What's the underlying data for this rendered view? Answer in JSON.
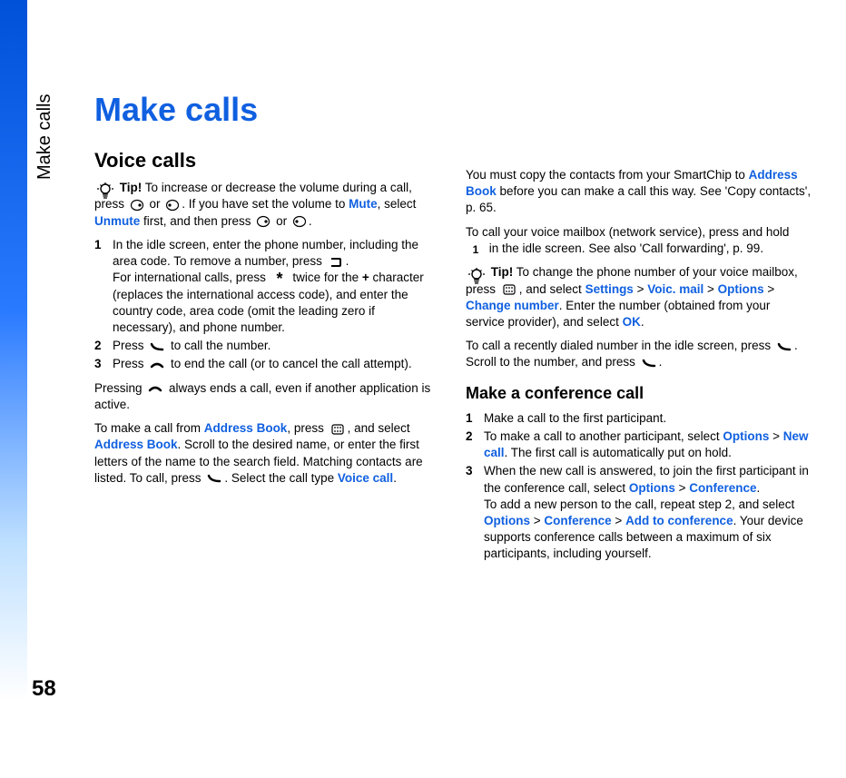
{
  "page_number": "58",
  "side_label": "Make calls",
  "title": "Make calls",
  "section_voice": "Voice calls",
  "tip_label": "Tip!",
  "tip1_a": " To increase or decrease the volume during a call, press ",
  "tip1_b": " or ",
  "tip1_c": ". If you have set the volume to ",
  "mute": "Mute",
  "tip1_d": ", select ",
  "unmute": "Unmute",
  "tip1_e": " first, and then press ",
  "tip1_f": " or ",
  "tip1_g": ".",
  "step1_a": "In the idle screen, enter the phone number, including the area code. To remove a number, press ",
  "step1_b": ".",
  "step1_c": "For international calls, press ",
  "step1_d": " twice for the ",
  "step1_plus": "+",
  "step1_e": " character (replaces the international access code), and enter the country code, area code (omit the leading zero if necessary), and phone number.",
  "step2_a": "Press ",
  "step2_b": " to call the number.",
  "step3_a": "Press ",
  "step3_b": " to end the call (or to cancel the call attempt).",
  "para_press_a": "Pressing ",
  "para_press_b": " always ends a call, even if another application is active.",
  "para_ab_a": "To make a call from ",
  "address_book": "Address Book",
  "para_ab_b": ", press ",
  "para_ab_c": ", and select ",
  "para_ab_d": ". Scroll to the desired name, or enter the first letters of the name to the search field. Matching contacts are listed. To call, press ",
  "para_ab_e": ". Select the call type ",
  "voice_call": "Voice call",
  "para_ab_f": ".",
  "col2_p1_a": "You must copy the contacts from your SmartChip to ",
  "col2_p1_b": " before you can make a call this way. See 'Copy contacts', p. 65.",
  "col2_p2_a": "To call your voice mailbox (network service), press and hold ",
  "col2_p2_b": " in the idle screen. See also 'Call forwarding', p. 99.",
  "tip2_a": " To change the phone number of your voice mailbox, press ",
  "tip2_b": ", and select ",
  "settings": "Settings",
  "gt": " > ",
  "voic_mail": "Voic. mail",
  "options": "Options",
  "change_number": "Change number",
  "tip2_c": ". Enter the number (obtained from your service provider), and select ",
  "ok": "OK",
  "tip2_d": ".",
  "col2_p3_a": "To call a recently dialed number in the idle screen, press ",
  "col2_p3_b": ". Scroll to the number, and press ",
  "col2_p3_c": ".",
  "section_conf": "Make a conference call",
  "conf1": "Make a call to the first participant.",
  "conf2_a": "To make a call to another participant, select ",
  "new_call": "New call",
  "conf2_b": ". The first call is automatically put on hold.",
  "conf3_a": "When the new call is answered, to join the first participant in the conference call, select ",
  "conference": "Conference",
  "conf3_b": ".",
  "conf3_c": "To add a new person to the call, repeat step 2, and select ",
  "add_to_conf": "Add to conference",
  "conf3_d": ". Your device supports conference calls between a maximum of six participants, including yourself.",
  "n1": "1",
  "n2": "2",
  "n3": "3"
}
